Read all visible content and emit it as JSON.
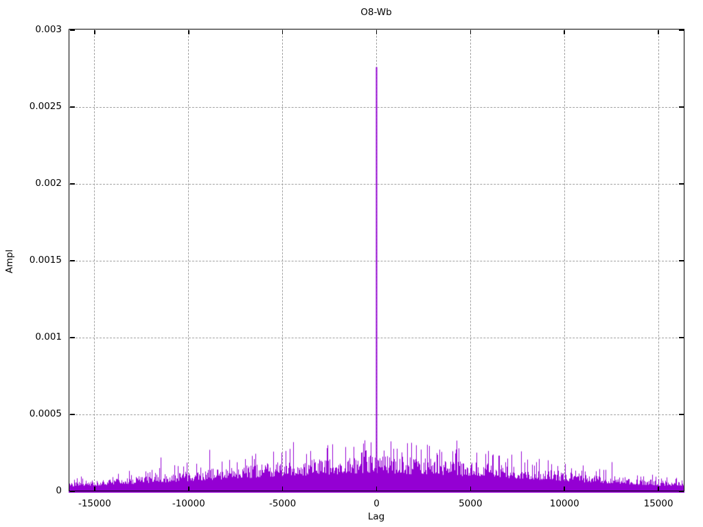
{
  "chart_data": {
    "type": "impulse",
    "title": "O8-Wb",
    "xlabel": "Lag",
    "ylabel": "Ampl",
    "xlim": [
      -16384,
      16384
    ],
    "ylim": [
      0,
      0.003
    ],
    "grid": true,
    "x_ticks": {
      "values": [
        -15000,
        -10000,
        -5000,
        0,
        5000,
        10000,
        15000
      ],
      "labels": [
        "-15000",
        "-10000",
        "-5000",
        "0",
        "5000",
        "10000",
        "15000"
      ]
    },
    "y_ticks": {
      "values": [
        0,
        0.0005,
        0.001,
        0.0015,
        0.002,
        0.0025,
        0.003
      ],
      "labels": [
        "0",
        "0.0005",
        "0.001",
        "0.0015",
        "0.002",
        "0.0025",
        "0.003"
      ]
    },
    "colors": {
      "line": "#9400d3",
      "grid": "#a0a0a0",
      "frame": "#000000",
      "background": "#ffffff"
    },
    "peak": {
      "lag": 0,
      "ampl": 0.00276
    },
    "noise_envelope": [
      [
        -16384,
        7e-05
      ],
      [
        -15000,
        8e-05
      ],
      [
        -13000,
        0.000105
      ],
      [
        -11000,
        0.00013
      ],
      [
        -9000,
        0.00016
      ],
      [
        -7000,
        0.00019
      ],
      [
        -5000,
        0.000215
      ],
      [
        -3000,
        0.000235
      ],
      [
        -1500,
        0.00025
      ],
      [
        0,
        0.00026
      ],
      [
        1500,
        0.00025
      ],
      [
        3000,
        0.000235
      ],
      [
        5000,
        0.000215
      ],
      [
        7000,
        0.00019
      ],
      [
        9000,
        0.00016
      ],
      [
        11000,
        0.00013
      ],
      [
        13000,
        0.000105
      ],
      [
        15000,
        8e-05
      ],
      [
        16384,
        7e-05
      ]
    ],
    "notable_spikes": [
      [
        -4450,
        0.00032
      ],
      [
        4250,
        0.00033
      ],
      [
        -8900,
        0.00027
      ],
      [
        -2600,
        0.0003
      ],
      [
        2100,
        0.0003
      ],
      [
        7700,
        0.00026
      ],
      [
        -11500,
        0.00022
      ],
      [
        12500,
        0.00019
      ]
    ],
    "seed": 42
  }
}
